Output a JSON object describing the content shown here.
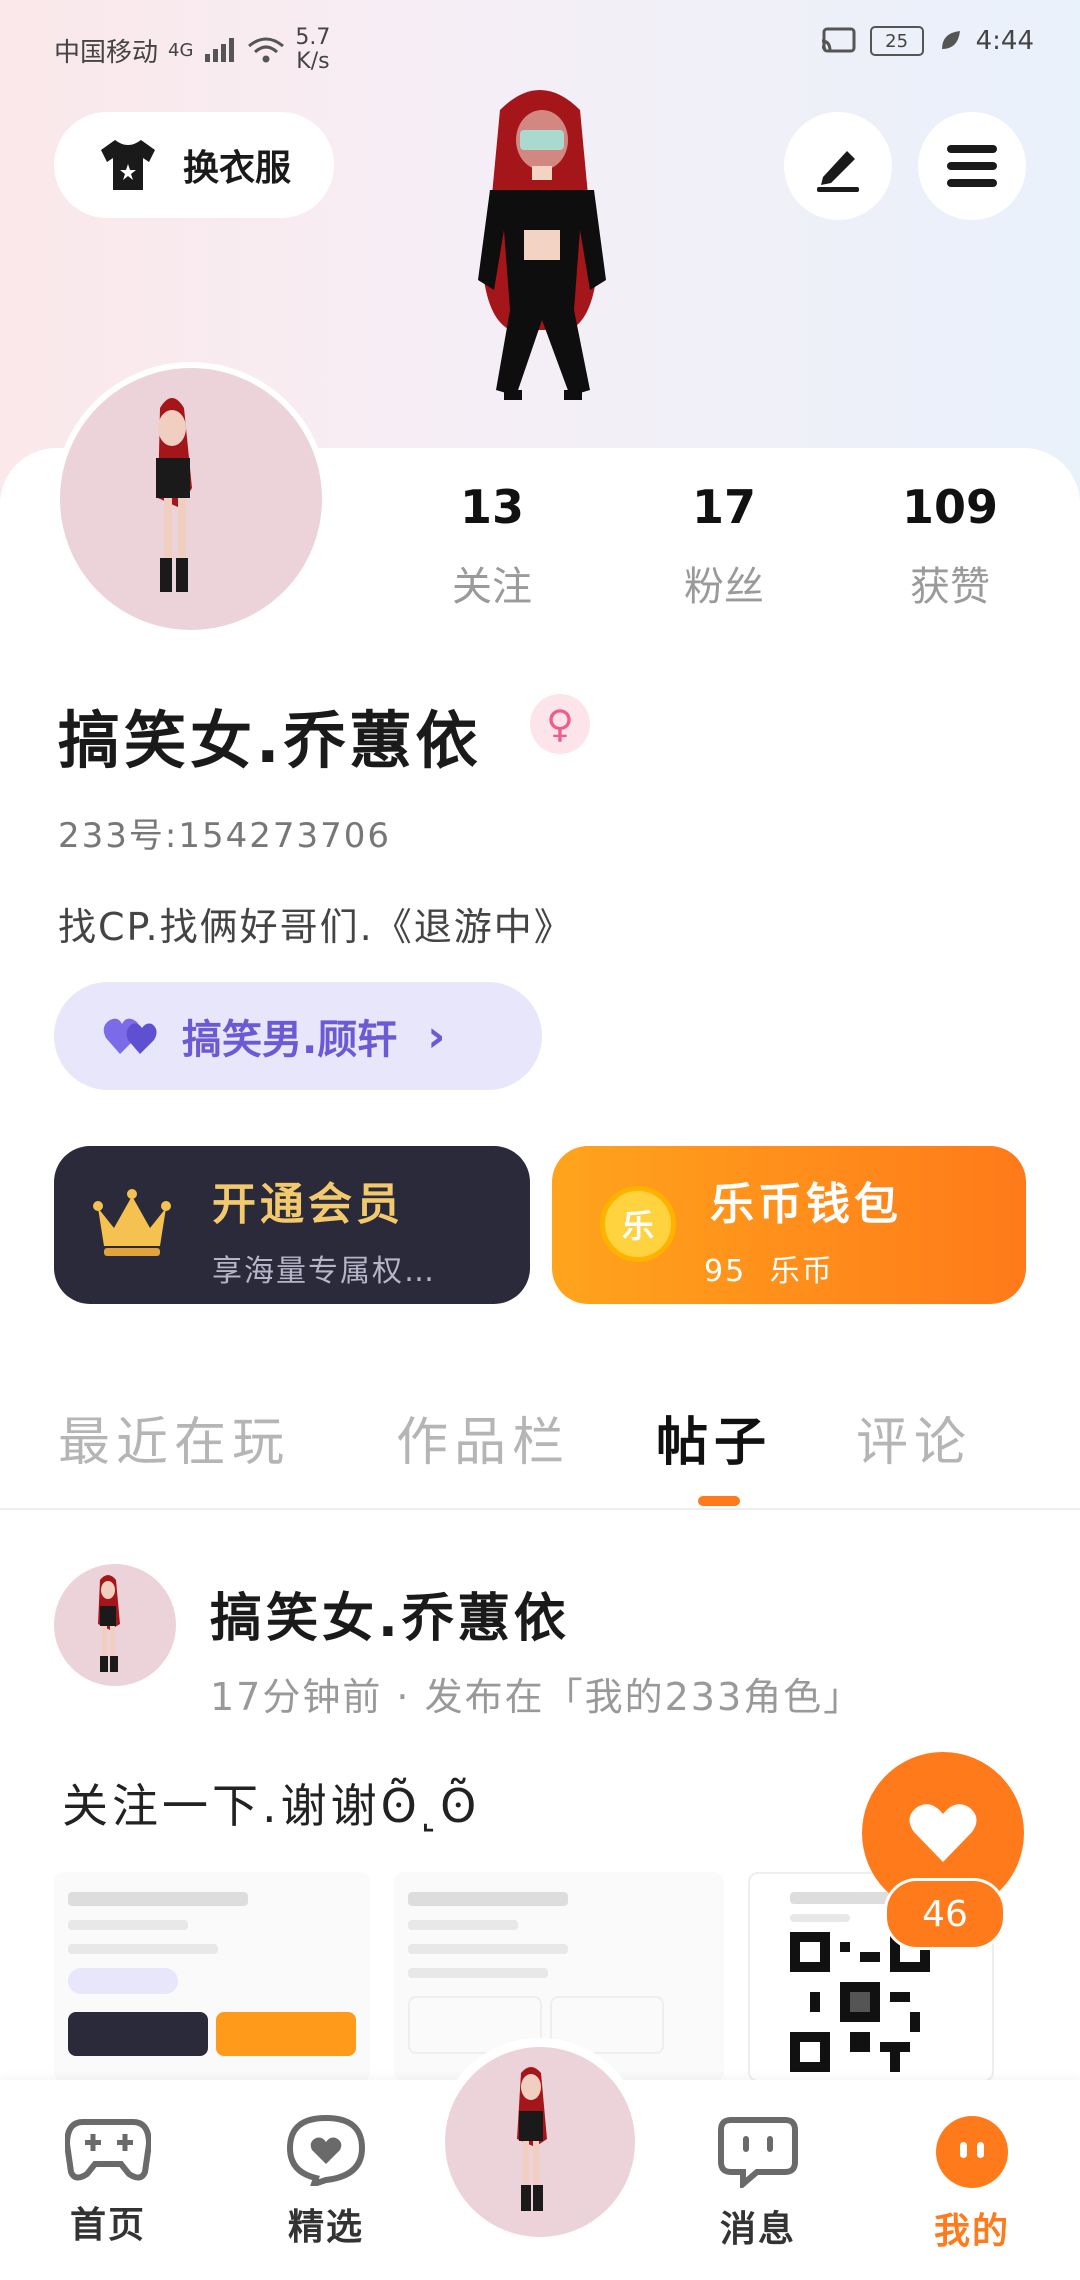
{
  "status_bar": {
    "carrier": "中国移动",
    "network": "4G",
    "speed_value": "5.7",
    "speed_unit": "K/s",
    "battery": "25",
    "time": "4:44"
  },
  "header": {
    "dress_up_label": "换衣服"
  },
  "profile": {
    "stats": [
      {
        "value": "13",
        "label": "关注"
      },
      {
        "value": "17",
        "label": "粉丝"
      },
      {
        "value": "109",
        "label": "获赞"
      }
    ],
    "name": "搞笑女.乔蕙依",
    "gender_symbol": "♀",
    "uid": "233号:154273706",
    "bio": "找CP.找俩好哥们.《退游中》",
    "cp": {
      "name": "搞笑男.顾轩",
      "chevron": "›"
    }
  },
  "cards": {
    "vip": {
      "title": "开通会员",
      "subtitle": "享海量专属权…"
    },
    "wallet": {
      "title": "乐币钱包",
      "coin_glyph": "乐",
      "balance": "95",
      "unit": "乐币"
    }
  },
  "tabs": [
    {
      "label": "最近在玩",
      "active": false
    },
    {
      "label": "作品栏",
      "active": false
    },
    {
      "label": "帖子",
      "active": true
    },
    {
      "label": "评论",
      "active": false
    }
  ],
  "post": {
    "author": "搞笑女.乔蕙依",
    "meta": "17分钟前 · 发布在「我的233角色」",
    "text": "关注一下.谢谢ʘ̃˻ʘ̃",
    "like_count": "46"
  },
  "bottom_nav": [
    {
      "label": "首页",
      "icon": "gamepad-icon",
      "active": false
    },
    {
      "label": "精选",
      "icon": "heart-chat-icon",
      "active": false
    },
    {
      "label": "消息",
      "icon": "message-icon",
      "active": false
    },
    {
      "label": "我的",
      "icon": "me-icon",
      "active": true
    }
  ],
  "colors": {
    "accent": "#ff7a1a",
    "vip_bg": "#2b2a3a",
    "cp_bg": "#e7e6fb"
  }
}
